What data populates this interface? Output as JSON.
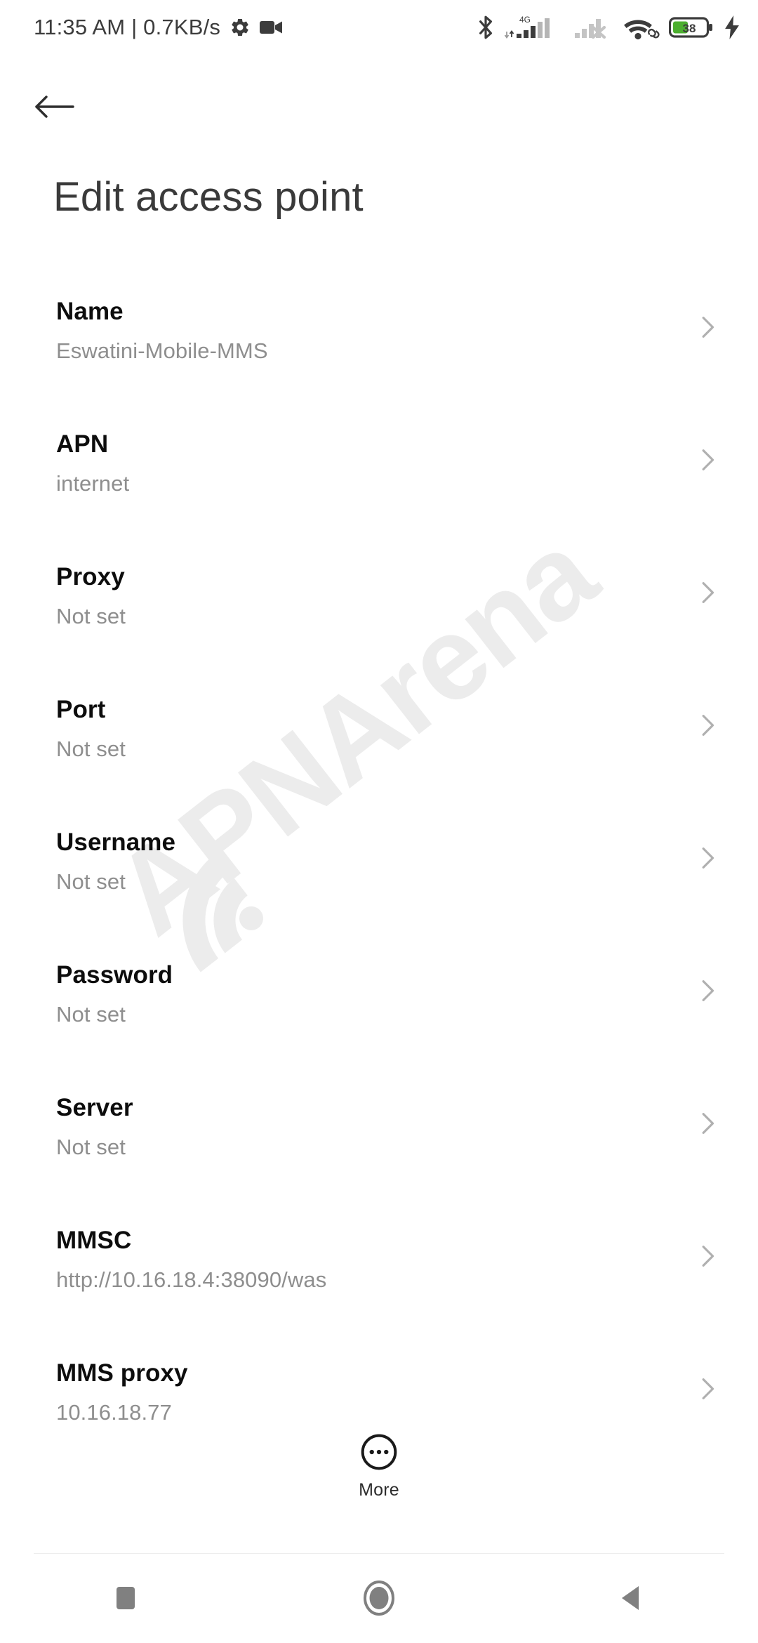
{
  "status_bar": {
    "clock": "11:35 AM | 0.7KB/s",
    "icons": [
      "gear-icon",
      "video-camera-icon",
      "bluetooth-icon",
      "signal-4g-icon",
      "signal-sim2-off-icon",
      "wifi-link-icon",
      "battery-icon",
      "charging-bolt-icon"
    ],
    "network_type": "4G",
    "battery_percent": "38",
    "battery_color": "#4caf2f"
  },
  "header": {
    "back_label": "Back",
    "title": "Edit access point"
  },
  "watermark": {
    "text": "APNArena",
    "color": "#ececec"
  },
  "list": {
    "rows": [
      {
        "title": "Name",
        "value": "Eswatini-Mobile-MMS"
      },
      {
        "title": "APN",
        "value": "internet"
      },
      {
        "title": "Proxy",
        "value": "Not set"
      },
      {
        "title": "Port",
        "value": "Not set"
      },
      {
        "title": "Username",
        "value": "Not set"
      },
      {
        "title": "Password",
        "value": "Not set"
      },
      {
        "title": "Server",
        "value": "Not set"
      },
      {
        "title": "MMSC",
        "value": "http://10.16.18.4:38090/was"
      },
      {
        "title": "MMS proxy",
        "value": "10.16.18.77"
      }
    ]
  },
  "more_button": {
    "label": "More",
    "icon": "overflow-dots-circle-icon"
  },
  "nav_bar": {
    "recents_label": "Recents",
    "home_label": "Home",
    "back_label": "Back",
    "color": "#808080"
  }
}
